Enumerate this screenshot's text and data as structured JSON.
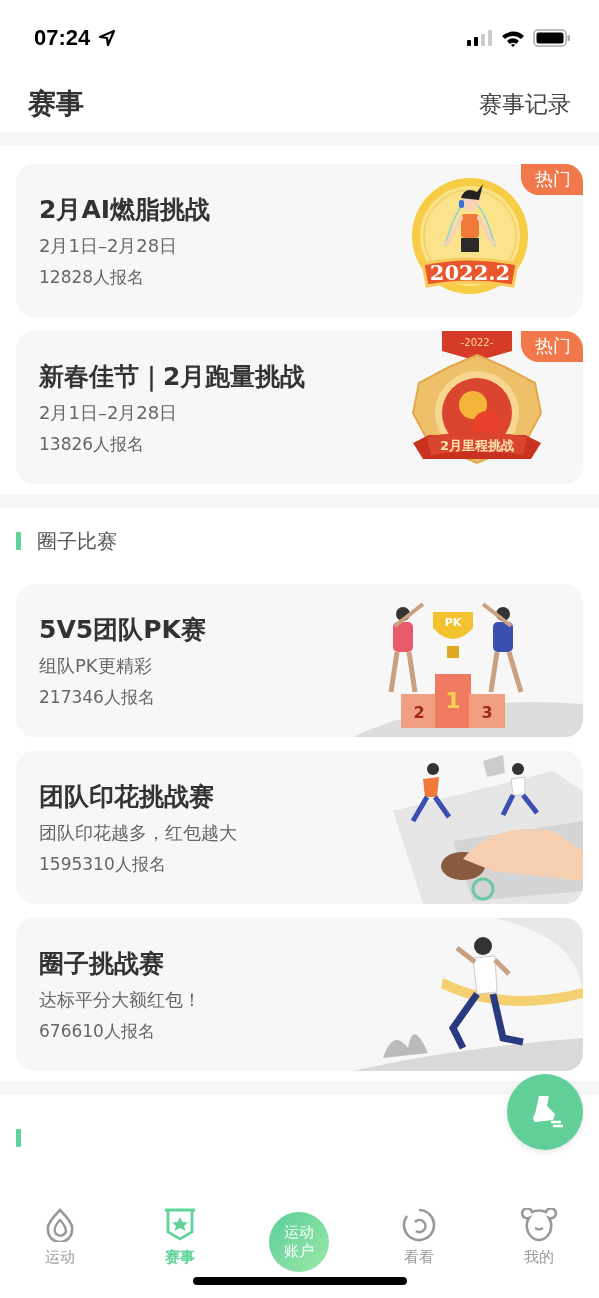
{
  "status_bar": {
    "time": "07:24"
  },
  "header": {
    "title": "赛事",
    "action": "赛事记录"
  },
  "featured": [
    {
      "title": "2月AI燃脂挑战",
      "dates": "2月1日–2月28日",
      "signups": "12828人报名",
      "badge": "热门",
      "medal": {
        "kind": "round",
        "label": "2022.2"
      }
    },
    {
      "title": "新春佳节｜2月跑量挑战",
      "dates": "2月1日–2月28日",
      "signups": "13826人报名",
      "badge": "热门",
      "medal": {
        "kind": "star",
        "top_label": "-2022-",
        "label": "2月里程挑战"
      }
    }
  ],
  "circle_section": {
    "title": "圈子比赛",
    "items": [
      {
        "title": "5V5团队PK赛",
        "subtitle": "组队PK更精彩",
        "signups": "217346人报名",
        "kind": "podium",
        "art_labels": [
          "PK",
          "2",
          "1",
          "3"
        ]
      },
      {
        "title": "团队印花挑战赛",
        "subtitle": "团队印花越多，红包越大",
        "signups": "1595310人报名",
        "kind": "stamp"
      },
      {
        "title": "圈子挑战赛",
        "subtitle": "达标平分大额红包！",
        "signups": "676610人报名",
        "kind": "finish"
      }
    ]
  },
  "tabs": [
    {
      "kind": "drop",
      "label": "运动",
      "selected": false
    },
    {
      "kind": "shield",
      "label": "赛事",
      "selected": true
    },
    {
      "kind": "center",
      "label": "运动账户",
      "selected": false
    },
    {
      "kind": "spiral",
      "label": "看看",
      "selected": false
    },
    {
      "kind": "bear",
      "label": "我的",
      "selected": false
    }
  ]
}
